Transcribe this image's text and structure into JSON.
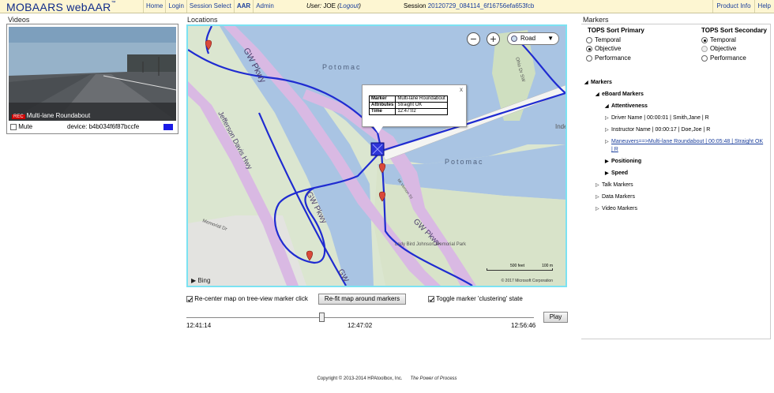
{
  "app": {
    "brand": "MOBAARS  webAAR",
    "brand_mark": "™"
  },
  "nav": [
    "Home",
    "Login",
    "Session Select",
    "AAR",
    "Admin"
  ],
  "user": {
    "label": "User:",
    "name": "JOE",
    "logout": "Logout"
  },
  "session": {
    "label": "Session",
    "id": "20120729_084114_6f16756efa653fcb"
  },
  "right_nav": [
    "Product Info",
    "Help"
  ],
  "videos": {
    "title": "Videos",
    "caption_tag": "REC",
    "caption": "Multi-lane Roundabout",
    "mute_label": "Mute",
    "mute_checked": false,
    "device": "device: b4b034f6f87bccfe",
    "swatch_color": "#1a1ae6"
  },
  "locations": {
    "title": "Locations",
    "map_type": "Road",
    "labels": {
      "potomac1": "Potomac",
      "potomac2": "Potomac",
      "gwpkwy1": "GW Pkwy",
      "gwpkwy2": "GW Pkwy",
      "gwpkwy3": "GW Pkwy",
      "gwpkwy4": "GW",
      "jefferson": "Jefferson Davis Hwy",
      "memorial": "Memorial Dr",
      "lbj": "Lady Bird Johnson Memorial Park",
      "ohio": "Ohio Dr SW",
      "mtvernon": "Mt Vernon Trl",
      "inde": "Inde"
    },
    "popup": {
      "close": "x",
      "rows": [
        {
          "k": "Marker",
          "v": "Multi-lane Roundabout"
        },
        {
          "k": "Attributes",
          "v": "Straight OK"
        },
        {
          "k": "Time",
          "v": "12:47:02"
        }
      ]
    },
    "scale_feet": "500 feet",
    "scale_m": "100 m",
    "copyright": "© 2017 Microsoft Corporation",
    "provider": "Bing",
    "recenter_label": "Re-center map on tree-view marker click",
    "refit_label": "Re-fit map around markers",
    "cluster_label": "Toggle marker 'clustering' state",
    "timeline": {
      "start": "12:41:14",
      "current": "12:47:02",
      "end": "12:56:46",
      "progress": 0.39
    },
    "play_label": "Play"
  },
  "markers": {
    "title": "Markers",
    "sort_primary": {
      "title": "TOPS Sort Primary",
      "options": [
        "Temporal",
        "Objective",
        "Performance"
      ],
      "selected": 1
    },
    "sort_secondary": {
      "title": "TOPS Sort Secondary",
      "options": [
        "Temporal",
        "Objective",
        "Performance"
      ],
      "selected": 0
    },
    "tree": {
      "root": "Markers",
      "eboard": "eBoard Markers",
      "attentiveness": "Attentiveness",
      "driver": "Driver Name | 00:00:01 | Smith,Jane | R",
      "instructor": "Instructor Name | 00:00:17 | Doe,Joe | R",
      "maneuver": "Maneuvers==>Multi-lane Roundabout | 00:05:48 | Straight OK",
      "maneuver_tail": "| R",
      "positioning": "Positioning",
      "speed": "Speed",
      "talk": "Talk Markers",
      "data": "Data Markers",
      "video": "Video Markers"
    }
  },
  "footer": {
    "copyright": "Copyright © 2013-2014 HPAtoolbox, Inc.",
    "tagline": "The Power of Process"
  }
}
